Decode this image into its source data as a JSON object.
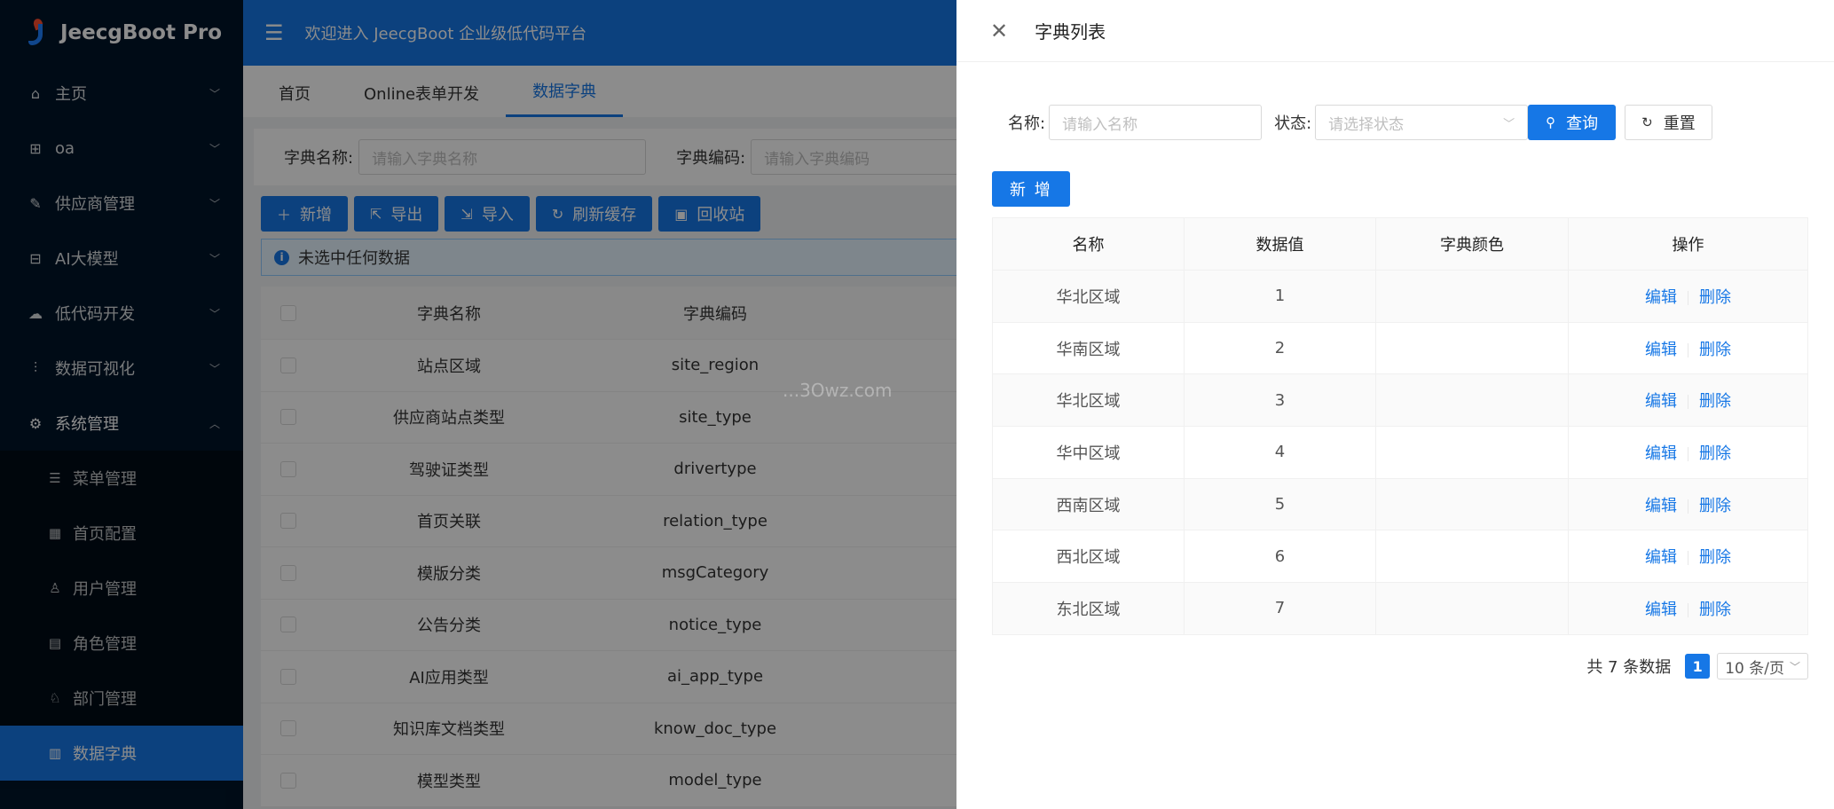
{
  "app": {
    "logo_text": "JeecgBoot Pro",
    "welcome": "欢迎进入 JeecgBoot 企业级低代码平台"
  },
  "sidebar": {
    "items": [
      {
        "label": "主页",
        "icon": "home-icon"
      },
      {
        "label": "oa",
        "icon": "grid-icon"
      },
      {
        "label": "供应商管理",
        "icon": "edit-icon"
      },
      {
        "label": "AI大模型",
        "icon": "ai-icon"
      },
      {
        "label": "低代码开发",
        "icon": "cloud-icon"
      },
      {
        "label": "数据可视化",
        "icon": "chart-icon"
      },
      {
        "label": "系统管理",
        "icon": "gear-icon"
      }
    ],
    "subitems": [
      {
        "label": "菜单管理",
        "icon": "menu-icon"
      },
      {
        "label": "首页配置",
        "icon": "layout-icon"
      },
      {
        "label": "用户管理",
        "icon": "user-icon"
      },
      {
        "label": "角色管理",
        "icon": "role-icon"
      },
      {
        "label": "部门管理",
        "icon": "dept-icon"
      },
      {
        "label": "数据字典",
        "icon": "dict-icon"
      }
    ]
  },
  "tabs": [
    "首页",
    "Online表单开发",
    "数据字典"
  ],
  "search": {
    "name_label": "字典名称:",
    "name_placeholder": "请输入字典名称",
    "code_label": "字典编码:",
    "code_placeholder": "请输入字典编码"
  },
  "toolbar": {
    "add": "新增",
    "export": "导出",
    "import": "导入",
    "refresh": "刷新缓存",
    "recycle": "回收站"
  },
  "alert": "未选中任何数据",
  "bg_table": {
    "headers": [
      "字典名称",
      "字典编码"
    ],
    "rows": [
      [
        "站点区域",
        "site_region"
      ],
      [
        "供应商站点类型",
        "site_type"
      ],
      [
        "驾驶证类型",
        "drivertype"
      ],
      [
        "首页关联",
        "relation_type"
      ],
      [
        "模版分类",
        "msgCategory"
      ],
      [
        "公告分类",
        "notice_type"
      ],
      [
        "AI应用类型",
        "ai_app_type"
      ],
      [
        "知识库文档类型",
        "know_doc_type"
      ],
      [
        "模型类型",
        "model_type"
      ]
    ]
  },
  "watermark": "...3Owz.com",
  "drawer": {
    "title": "字典列表",
    "name_label": "名称:",
    "name_placeholder": "请输入名称",
    "status_label": "状态:",
    "status_placeholder": "请选择状态",
    "query": "查询",
    "reset": "重置",
    "add": "新 增",
    "headers": [
      "名称",
      "数据值",
      "字典颜色",
      "操作"
    ],
    "rows": [
      {
        "name": "华北区域",
        "value": "1"
      },
      {
        "name": "华南区域",
        "value": "2"
      },
      {
        "name": "华北区域",
        "value": "3"
      },
      {
        "name": "华中区域",
        "value": "4"
      },
      {
        "name": "西南区域",
        "value": "5"
      },
      {
        "name": "西北区域",
        "value": "6"
      },
      {
        "name": "东北区域",
        "value": "7"
      }
    ],
    "edit": "编辑",
    "delete": "删除",
    "total": "共 7 条数据",
    "page": "1",
    "page_size": "10 条/页"
  }
}
